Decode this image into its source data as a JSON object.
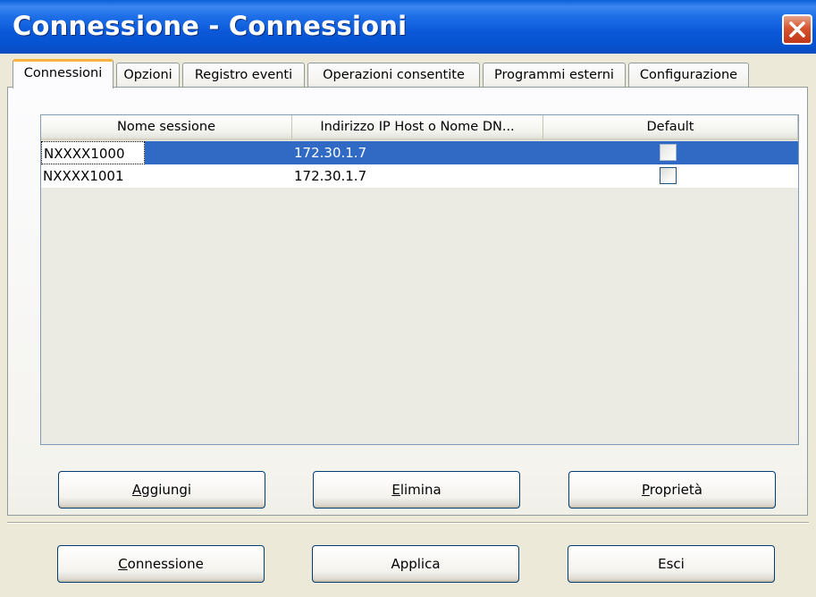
{
  "window": {
    "title": "Connessione - Connessioni",
    "close_icon": "close-icon",
    "colors": {
      "titlebar": "#0a58d8",
      "selection": "#316ac5",
      "close": "#d5542e"
    }
  },
  "tabs": [
    {
      "label": "Connessioni",
      "active": true
    },
    {
      "label": "Opzioni",
      "active": false
    },
    {
      "label": "Registro eventi",
      "active": false
    },
    {
      "label": "Operazioni consentite",
      "active": false
    },
    {
      "label": "Programmi esterni",
      "active": false
    },
    {
      "label": "Configurazione",
      "active": false
    }
  ],
  "table": {
    "columns": [
      "Nome sessione",
      "Indirizzo IP Host o Nome DN...",
      "Default"
    ],
    "rows": [
      {
        "name": "NXXXX1000",
        "host": "172.30.1.7",
        "default": false,
        "selected": true
      },
      {
        "name": "NXXXX1001",
        "host": "172.30.1.7",
        "default": false,
        "selected": false
      }
    ]
  },
  "buttons": {
    "add": {
      "mnemonic": "A",
      "rest": "ggiungi"
    },
    "delete": {
      "mnemonic": "E",
      "rest": "limina"
    },
    "properties": {
      "mnemonic": "P",
      "rest": "roprietà"
    },
    "connect": {
      "mnemonic": "C",
      "rest": "onnessione"
    },
    "apply": {
      "label": "Applica"
    },
    "exit": {
      "label": "Esci"
    }
  }
}
